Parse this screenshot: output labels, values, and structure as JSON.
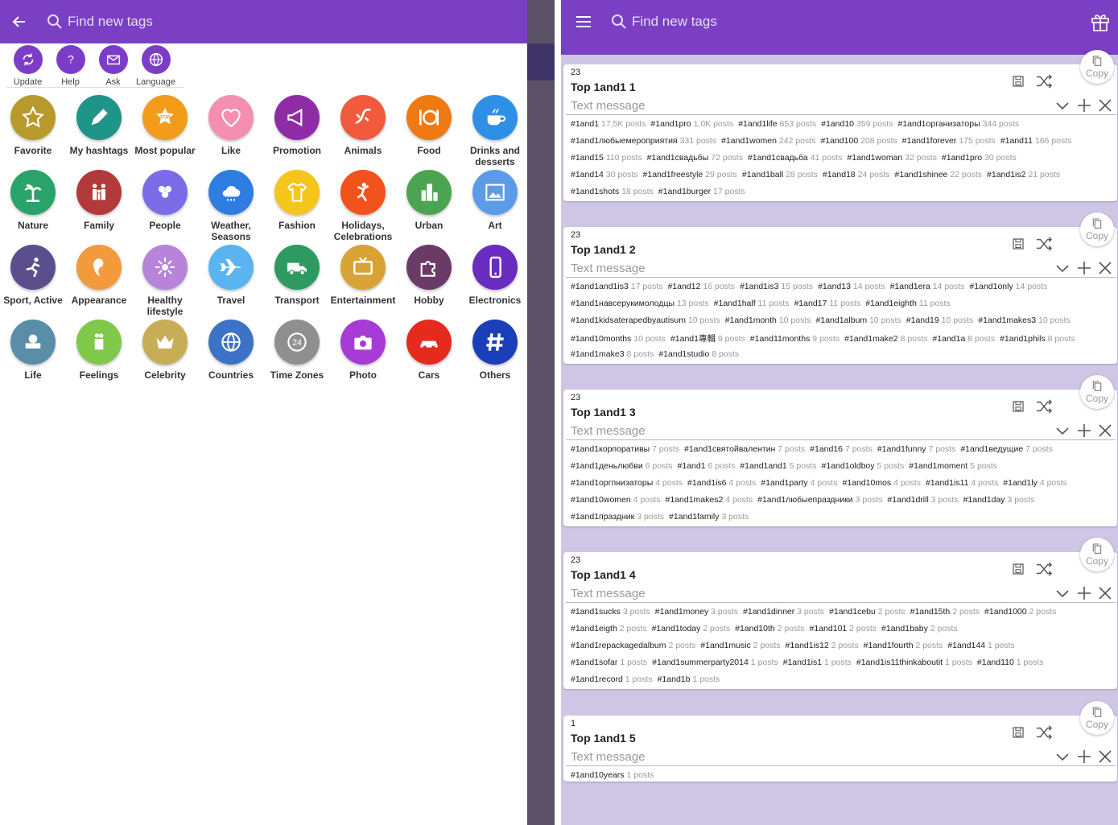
{
  "left": {
    "search_placeholder": "Find new tags",
    "toolbar": [
      {
        "label": "Update",
        "icon": "refresh-icon"
      },
      {
        "label": "Help",
        "icon": "help-icon"
      },
      {
        "label": "Ask",
        "icon": "mail-icon"
      },
      {
        "label": "Language",
        "icon": "globe-icon"
      }
    ],
    "categories": [
      {
        "label": "Favorite",
        "color": "#b89a2c",
        "icon": "star-icon"
      },
      {
        "label": "My hashtags",
        "color": "#1f9488",
        "icon": "pencil-icon"
      },
      {
        "label": "Most popular",
        "color": "#f39b1b",
        "icon": "top-badge-icon"
      },
      {
        "label": "Like",
        "color": "#f48fb1",
        "icon": "heart-icon"
      },
      {
        "label": "Promotion",
        "color": "#8e2ca6",
        "icon": "megaphone-icon"
      },
      {
        "label": "Animals",
        "color": "#f15a3d",
        "icon": "lizard-icon"
      },
      {
        "label": "Food",
        "color": "#f07a12",
        "icon": "plate-icon"
      },
      {
        "label": "Drinks and\ndesserts",
        "color": "#2e8fe7",
        "icon": "cup-icon"
      },
      {
        "label": "Nature",
        "color": "#2aa36a",
        "icon": "palm-icon"
      },
      {
        "label": "Family",
        "color": "#b23a3a",
        "icon": "family-icon"
      },
      {
        "label": "People",
        "color": "#7d6ce8",
        "icon": "people-icon"
      },
      {
        "label": "Weather,\nSeasons",
        "color": "#2f7de1",
        "icon": "cloud-icon"
      },
      {
        "label": "Fashion",
        "color": "#f5c51b",
        "icon": "shirt-icon"
      },
      {
        "label": "Holidays,\nCelebrations",
        "color": "#f2531c",
        "icon": "dancer-icon"
      },
      {
        "label": "Urban",
        "color": "#4ba451",
        "icon": "building-icon"
      },
      {
        "label": "Art",
        "color": "#5c9be8",
        "icon": "picture-icon"
      },
      {
        "label": "Sport, Active",
        "color": "#5a4f8c",
        "icon": "runner-icon"
      },
      {
        "label": "Appearance",
        "color": "#f39a3c",
        "icon": "face-icon"
      },
      {
        "label": "Healthy\nlifestyle",
        "color": "#b784d9",
        "icon": "sparkle-icon"
      },
      {
        "label": "Travel",
        "color": "#5ab4ef",
        "icon": "plane-icon"
      },
      {
        "label": "Transport",
        "color": "#2e9a62",
        "icon": "truck-icon"
      },
      {
        "label": "Entertainment",
        "color": "#d9a235",
        "icon": "tv-icon"
      },
      {
        "label": "Hobby",
        "color": "#6b3b67",
        "icon": "puzzle-icon"
      },
      {
        "label": "Electronics",
        "color": "#6a2bbf",
        "icon": "phone-icon"
      },
      {
        "label": "Life",
        "color": "#5a8ea8",
        "icon": "armchair-icon"
      },
      {
        "label": "Feelings",
        "color": "#7fc84a",
        "icon": "hug-icon"
      },
      {
        "label": "Celebrity",
        "color": "#c6ad56",
        "icon": "crown-icon"
      },
      {
        "label": "Countries",
        "color": "#3d73c6",
        "icon": "globe-icon"
      },
      {
        "label": "Time Zones",
        "color": "#8f8f8f",
        "icon": "clock-24-icon"
      },
      {
        "label": "Photo",
        "color": "#a63bd6",
        "icon": "camera-icon"
      },
      {
        "label": "Cars",
        "color": "#e62a1e",
        "icon": "car-icon"
      },
      {
        "label": "Others",
        "color": "#1a3fb8",
        "icon": "hash-icon"
      }
    ]
  },
  "right": {
    "search_placeholder": "Find new tags",
    "copy_label": "Copy",
    "message_placeholder": "Text message",
    "cards": [
      {
        "num": "23",
        "title": "Top 1and1 1",
        "lines": [
          [
            [
              "#1and1",
              "17,5K posts"
            ],
            [
              "#1and1pro",
              "1,0K posts"
            ],
            [
              "#1and1life",
              "653 posts"
            ],
            [
              "#1and10",
              "359 posts"
            ],
            [
              "#1and1организаторы",
              "344 posts"
            ]
          ],
          [
            [
              "#1and1любыемероприятия",
              "331 posts"
            ],
            [
              "#1and1women",
              "242 posts"
            ],
            [
              "#1and100",
              "208 posts"
            ],
            [
              "#1and1forever",
              "175 posts"
            ],
            [
              "#1and11",
              "166 posts"
            ]
          ],
          [
            [
              "#1and15",
              "110 posts"
            ],
            [
              "#1and1свадьбы",
              "72 posts"
            ],
            [
              "#1and1свадьба",
              "41 posts"
            ],
            [
              "#1and1woman",
              "32 posts"
            ],
            [
              "#1and1pro",
              "30 posts"
            ]
          ],
          [
            [
              "#1and14",
              "30 posts"
            ],
            [
              "#1and1freestyle",
              "29 posts"
            ],
            [
              "#1and1ball",
              "28 posts"
            ],
            [
              "#1and18",
              "24 posts"
            ],
            [
              "#1and1shinee",
              "22 posts"
            ],
            [
              "#1and1is2",
              "21 posts"
            ]
          ],
          [
            [
              "#1and1shots",
              "18 posts"
            ],
            [
              "#1and1burger",
              "17 posts"
            ]
          ]
        ]
      },
      {
        "num": "23",
        "title": "Top 1and1 2",
        "lines": [
          [
            [
              "#1and1and1is3",
              "17 posts"
            ],
            [
              "#1and12",
              "16 posts"
            ],
            [
              "#1and1is3",
              "15 posts"
            ],
            [
              "#1and13",
              "14 posts"
            ],
            [
              "#1and1era",
              "14 posts"
            ],
            [
              "#1and1only",
              "14 posts"
            ]
          ],
          [
            [
              "#1and1навсерукимолодцы",
              "13 posts"
            ],
            [
              "#1and1half",
              "11 posts"
            ],
            [
              "#1and17",
              "11 posts"
            ],
            [
              "#1and1eighth",
              "11 posts"
            ]
          ],
          [
            [
              "#1and1kidsaterapedbyautisum",
              "10 posts"
            ],
            [
              "#1and1month",
              "10 posts"
            ],
            [
              "#1and1album",
              "10 posts"
            ],
            [
              "#1and19",
              "10 posts"
            ],
            [
              "#1and1makes3",
              "10 posts"
            ]
          ],
          [
            [
              "#1and10months",
              "10 posts"
            ],
            [
              "#1and1專輯",
              "9 posts"
            ],
            [
              "#1and11months",
              "9 posts"
            ],
            [
              "#1and1make2",
              "8 posts"
            ],
            [
              "#1and1a",
              "8 posts"
            ],
            [
              "#1and1phils",
              "8 posts"
            ]
          ],
          [
            [
              "#1and1make3",
              "8 posts"
            ],
            [
              "#1and1studio",
              "8 posts"
            ]
          ]
        ]
      },
      {
        "num": "23",
        "title": "Top 1and1 3",
        "lines": [
          [
            [
              "#1and1корпоративы",
              "7 posts"
            ],
            [
              "#1and1святойвалентин",
              "7 posts"
            ],
            [
              "#1and16",
              "7 posts"
            ],
            [
              "#1and1funny",
              "7 posts"
            ],
            [
              "#1and1ведущие",
              "7 posts"
            ]
          ],
          [
            [
              "#1and1деньлюбви",
              "6 posts"
            ],
            [
              "#1and1",
              "6 posts"
            ],
            [
              "#1and1and1",
              "5 posts"
            ],
            [
              "#1and1oldboy",
              "5 posts"
            ],
            [
              "#1and1moment",
              "5 posts"
            ]
          ],
          [
            [
              "#1and1оргпнизаторы",
              "4 posts"
            ],
            [
              "#1and1is6",
              "4 posts"
            ],
            [
              "#1and1party",
              "4 posts"
            ],
            [
              "#1and10mos",
              "4 posts"
            ],
            [
              "#1and1is11",
              "4 posts"
            ],
            [
              "#1and1ly",
              "4 posts"
            ]
          ],
          [
            [
              "#1and10women",
              "4 posts"
            ],
            [
              "#1and1makes2",
              "4 posts"
            ],
            [
              "#1and1любыепраздники",
              "3 posts"
            ],
            [
              "#1and1drill",
              "3 posts"
            ],
            [
              "#1and1day",
              "3 posts"
            ]
          ],
          [
            [
              "#1and1праздник",
              "3 posts"
            ],
            [
              "#1and1family",
              "3 posts"
            ]
          ]
        ]
      },
      {
        "num": "23",
        "title": "Top 1and1 4",
        "lines": [
          [
            [
              "#1and1sucks",
              "3 posts"
            ],
            [
              "#1and1money",
              "3 posts"
            ],
            [
              "#1and1dinner",
              "3 posts"
            ],
            [
              "#1and1cebu",
              "2 posts"
            ],
            [
              "#1and15th",
              "2 posts"
            ],
            [
              "#1and1000",
              "2 posts"
            ]
          ],
          [
            [
              "#1and1eigth",
              "2 posts"
            ],
            [
              "#1and1today",
              "2 posts"
            ],
            [
              "#1and10th",
              "2 posts"
            ],
            [
              "#1and101",
              "2 posts"
            ],
            [
              "#1and1baby",
              "2 posts"
            ]
          ],
          [
            [
              "#1and1repackagedalbum",
              "2 posts"
            ],
            [
              "#1and1music",
              "2 posts"
            ],
            [
              "#1and1is12",
              "2 posts"
            ],
            [
              "#1and1fourth",
              "2 posts"
            ],
            [
              "#1and144",
              "1 posts"
            ]
          ],
          [
            [
              "#1and1sofar",
              "1 posts"
            ],
            [
              "#1and1summerparty2014",
              "1 posts"
            ],
            [
              "#1and1is1",
              "1 posts"
            ],
            [
              "#1and1is11thinkaboutit",
              "1 posts"
            ],
            [
              "#1and110",
              "1 posts"
            ]
          ],
          [
            [
              "#1and1record",
              "1 posts"
            ],
            [
              "#1and1b",
              "1 posts"
            ]
          ]
        ]
      },
      {
        "num": "1",
        "title": "Top 1and1 5",
        "lines": [
          [
            [
              "#1and10years",
              "1 posts"
            ]
          ]
        ]
      }
    ]
  }
}
